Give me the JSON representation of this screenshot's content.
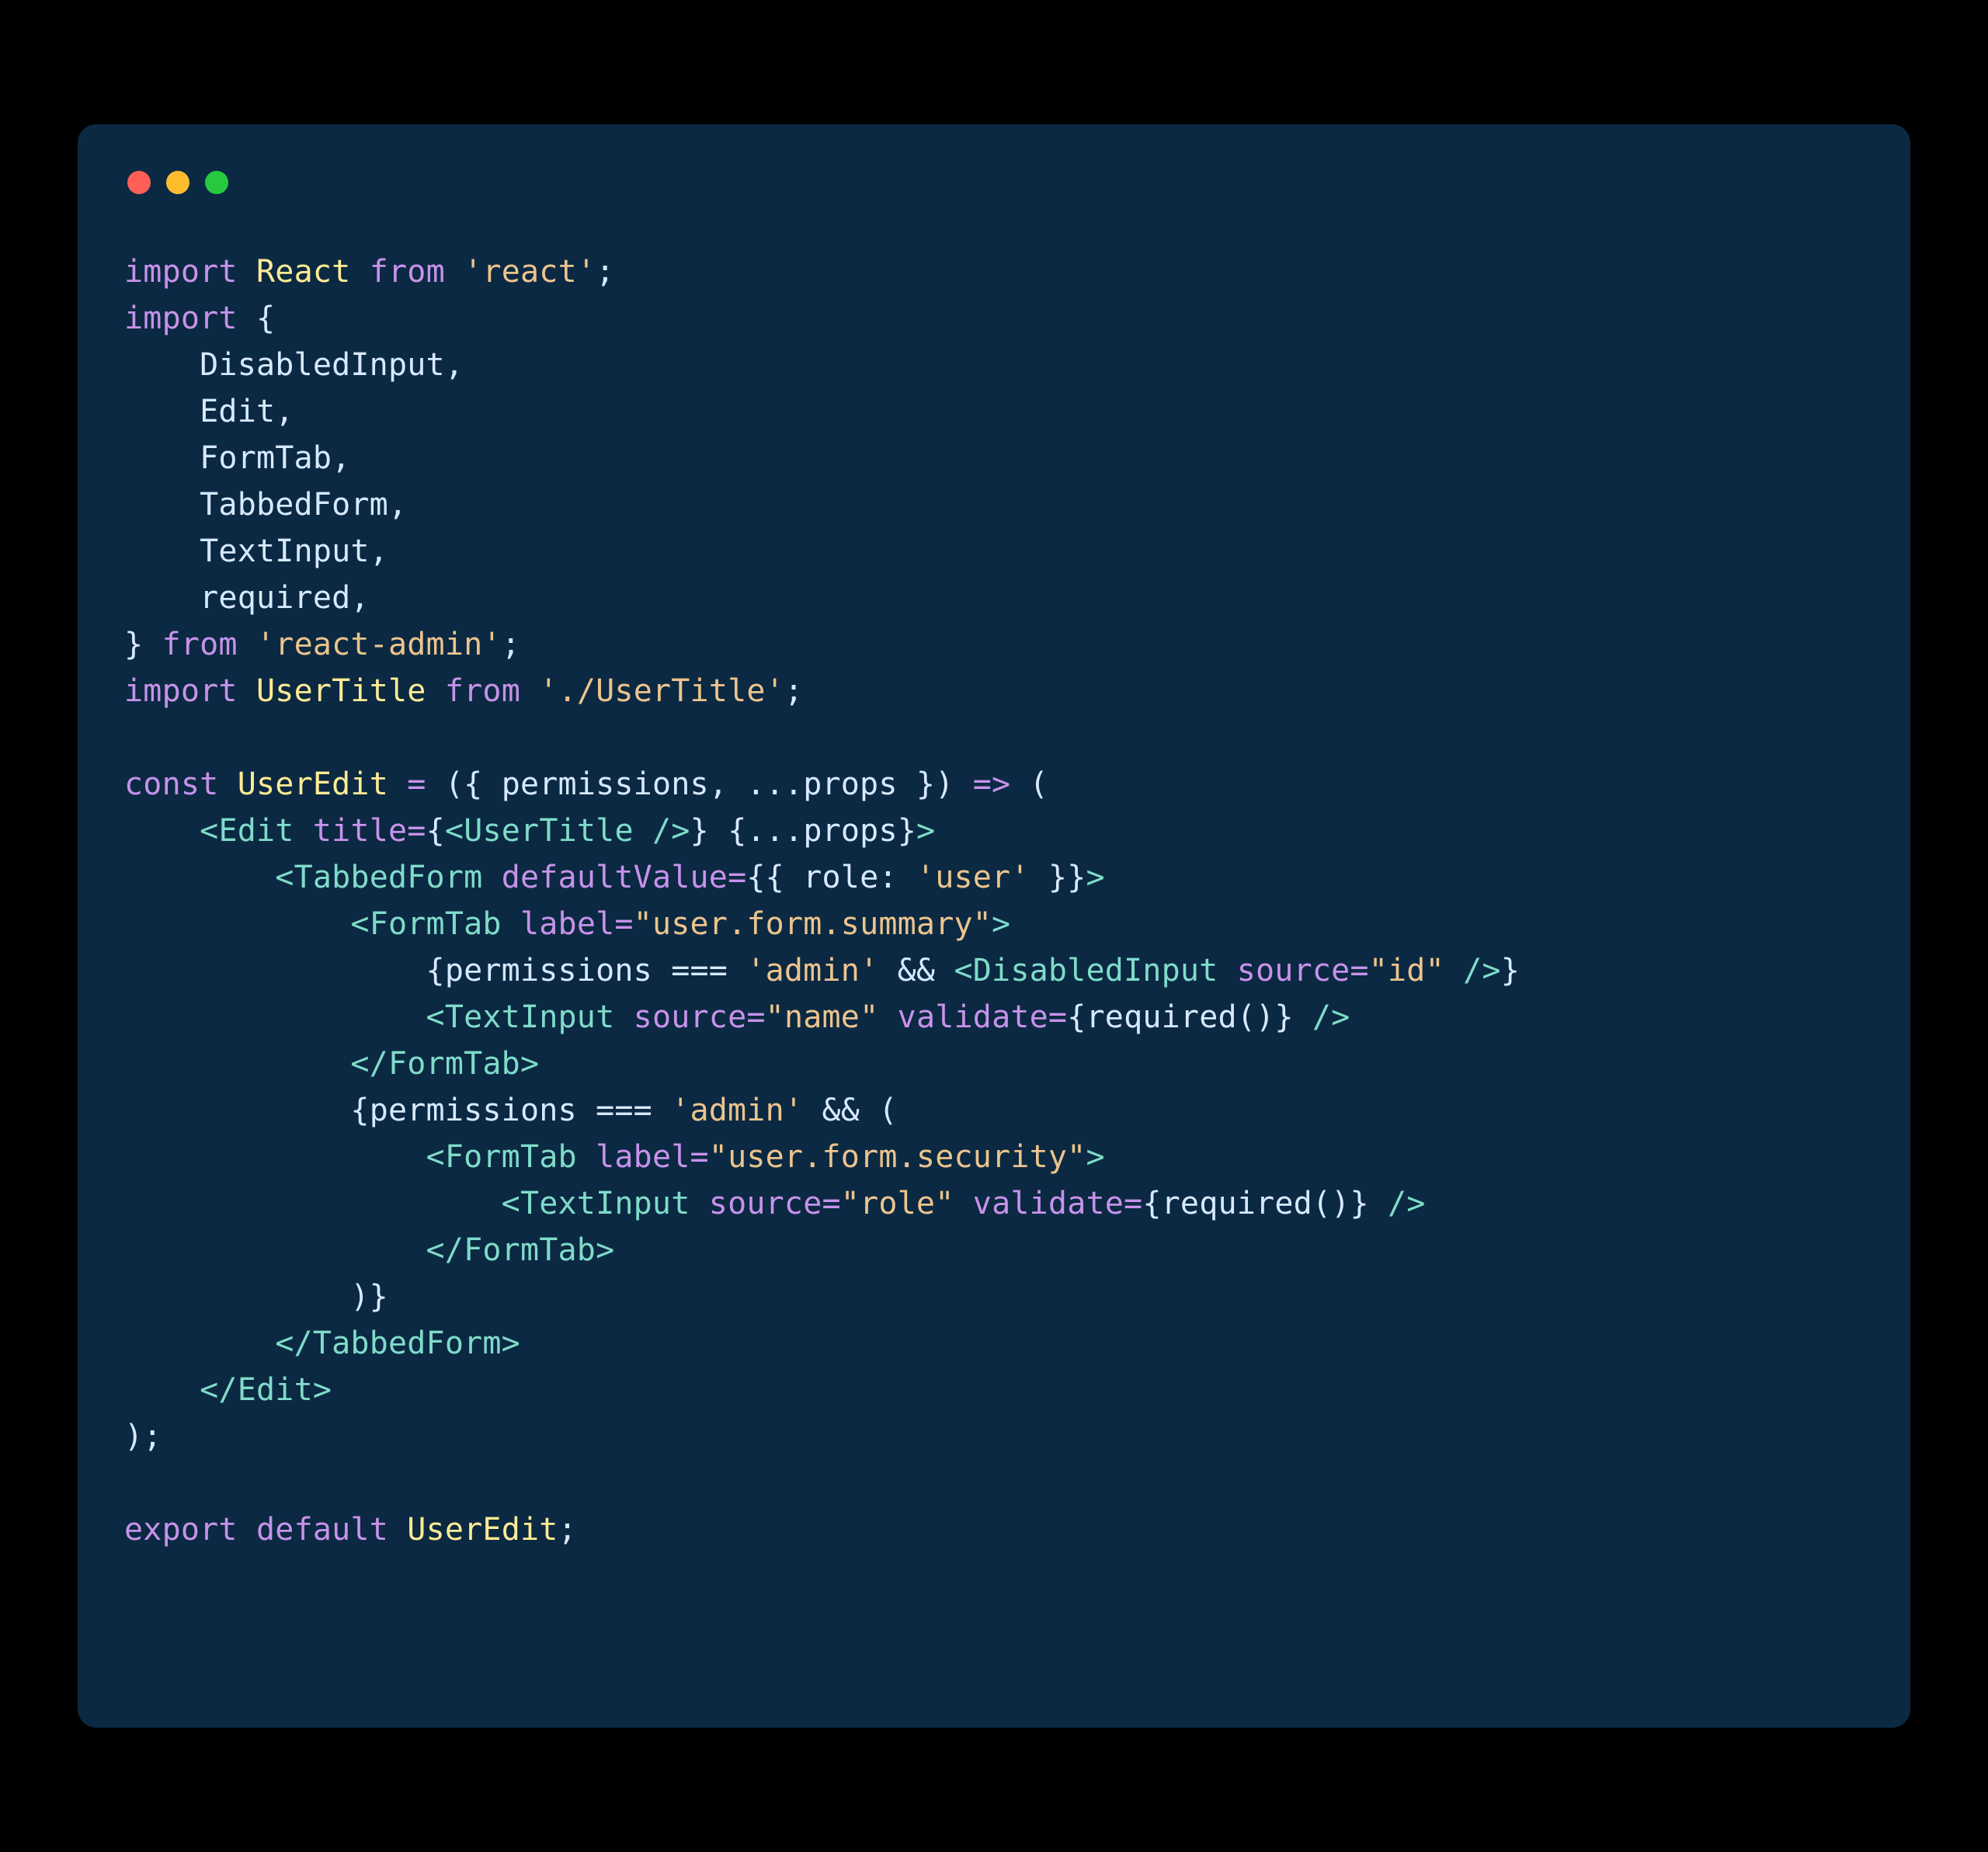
{
  "lines": {
    "l1_import": "import",
    "l1_react": "React",
    "l1_from": "from",
    "l1_str": "'react'",
    "l1_semi": ";",
    "l2_import": "import",
    "l2_brace": " {",
    "l3": "    DisabledInput,",
    "l4": "    Edit,",
    "l5": "    FormTab,",
    "l6": "    TabbedForm,",
    "l7": "    TextInput,",
    "l8": "    required,",
    "l9_brace": "} ",
    "l9_from": "from",
    "l9_str": "'react-admin'",
    "l9_semi": ";",
    "l10_import": "import",
    "l10_ut": "UserTitle",
    "l10_from": "from",
    "l10_str": "'./UserTitle'",
    "l10_semi": ";",
    "l12_const": "const",
    "l12_name": "UserEdit",
    "l12_eq": " = ",
    "l12_params": "({ permissions, ...props })",
    "l12_arrow": " => ",
    "l12_paren": "(",
    "l13_pre": "    ",
    "l13_open": "<",
    "l13_tag": "Edit",
    "l13_sp": " ",
    "l13_attr": "title",
    "l13_eq": "=",
    "l13_b1": "{",
    "l13_ut_open": "<",
    "l13_ut": "UserTitle",
    "l13_ut_close": " />",
    "l13_b2": "}",
    "l13_sp2": " ",
    "l13_spread": "{...props}",
    "l13_close": ">",
    "l14_pre": "        ",
    "l14_open": "<",
    "l14_tag": "TabbedForm",
    "l14_sp": " ",
    "l14_attr": "defaultValue",
    "l14_eq": "=",
    "l14_val": "{{ role: ",
    "l14_str": "'user'",
    "l14_val2": " }}",
    "l14_close": ">",
    "l15_pre": "            ",
    "l15_open": "<",
    "l15_tag": "FormTab",
    "l15_sp": " ",
    "l15_attr": "label",
    "l15_eq": "=",
    "l15_str": "\"user.form.summary\"",
    "l15_close": ">",
    "l16_pre": "                ",
    "l16_b1": "{",
    "l16_expr": "permissions === ",
    "l16_str": "'admin'",
    "l16_and": " && ",
    "l16_open": "<",
    "l16_tag": "DisabledInput",
    "l16_sp": " ",
    "l16_attr": "source",
    "l16_eq": "=",
    "l16_astr": "\"id\"",
    "l16_close": " />",
    "l16_b2": "}",
    "l17_pre": "                ",
    "l17_open": "<",
    "l17_tag": "TextInput",
    "l17_sp": " ",
    "l17_a1": "source",
    "l17_eq1": "=",
    "l17_s1": "\"name\"",
    "l17_sp2": " ",
    "l17_a2": "validate",
    "l17_eq2": "=",
    "l17_v": "{required()}",
    "l17_close": " />",
    "l18_pre": "            ",
    "l18_open": "</",
    "l18_tag": "FormTab",
    "l18_close": ">",
    "l19_pre": "            ",
    "l19_b1": "{",
    "l19_expr": "permissions === ",
    "l19_str": "'admin'",
    "l19_and": " && (",
    "l20_pre": "                ",
    "l20_open": "<",
    "l20_tag": "FormTab",
    "l20_sp": " ",
    "l20_attr": "label",
    "l20_eq": "=",
    "l20_str": "\"user.form.security\"",
    "l20_close": ">",
    "l21_pre": "                    ",
    "l21_open": "<",
    "l21_tag": "TextInput",
    "l21_sp": " ",
    "l21_a1": "source",
    "l21_eq1": "=",
    "l21_s1": "\"role\"",
    "l21_sp2": " ",
    "l21_a2": "validate",
    "l21_eq2": "=",
    "l21_v": "{required()}",
    "l21_close": " />",
    "l22_pre": "                ",
    "l22_open": "</",
    "l22_tag": "FormTab",
    "l22_close": ">",
    "l23": "            )}",
    "l24_pre": "        ",
    "l24_open": "</",
    "l24_tag": "TabbedForm",
    "l24_close": ">",
    "l25_pre": "    ",
    "l25_open": "</",
    "l25_tag": "Edit",
    "l25_close": ">",
    "l26": ");",
    "l28_export": "export",
    "l28_default": "default",
    "l28_name": "UserEdit",
    "l28_semi": ";"
  }
}
